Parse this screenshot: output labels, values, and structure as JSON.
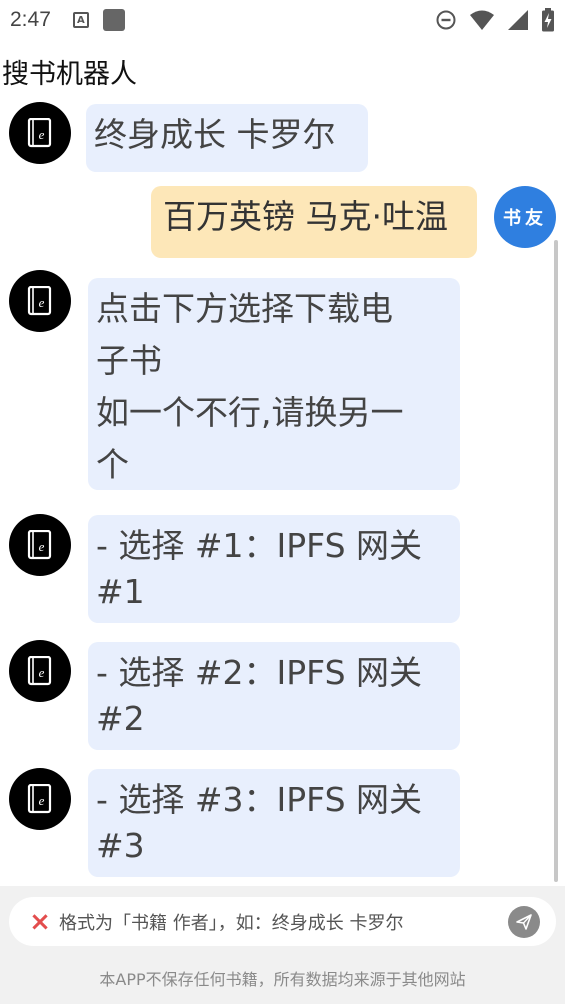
{
  "status_bar": {
    "time": "2:47",
    "a_icon": "A",
    "icons": [
      "dnd-icon",
      "wifi-icon",
      "signal-icon",
      "battery-charging-icon"
    ]
  },
  "header": {
    "title": "搜书机器人"
  },
  "user": {
    "avatar_label": "书友"
  },
  "messages": [
    {
      "from": "bot",
      "lines": [
        "终身成长 卡罗尔"
      ]
    },
    {
      "from": "user",
      "lines": [
        "百万英镑 马克·吐温"
      ]
    },
    {
      "from": "bot",
      "lines": [
        "点击下方选择下载电",
        "子书",
        "如一个不行,请换另一",
        "个"
      ]
    },
    {
      "from": "bot",
      "lines": [
        "- 选择 #1：IPFS 网关",
        "#1"
      ]
    },
    {
      "from": "bot",
      "lines": [
        "- 选择 #2：IPFS 网关",
        "#2"
      ]
    },
    {
      "from": "bot",
      "lines": [
        "- 选择 #3：IPFS 网关",
        "#3"
      ]
    }
  ],
  "input": {
    "placeholder": "格式为「书籍 作者」，如：终身成长 卡罗尔",
    "clear_icon": "close-icon",
    "send_icon": "send-icon"
  },
  "footer": {
    "note": "本APP不保存任何书籍，所有数据均来源于其他网站"
  },
  "colors": {
    "bot_bubble": "#e8effd",
    "user_bubble": "#fde7b8",
    "user_avatar": "#2f7fe0",
    "clear_icon": "#e34d4d"
  }
}
